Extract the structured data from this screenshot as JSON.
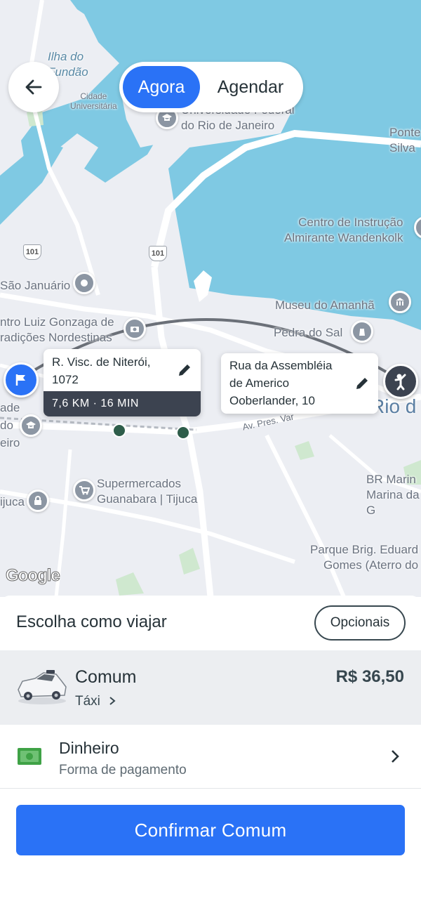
{
  "header": {
    "back_icon": "arrow-left-icon",
    "mode_options": [
      "Agora",
      "Agendar"
    ],
    "selected_mode": "Agora"
  },
  "map": {
    "labels": {
      "ilha": "Ilha do\nFundão",
      "cidade": "Cidade\nUniversitária",
      "ufrj": "Universidade Federal\ndo Rio de Janeiro",
      "ponte": "Ponte\nSilva",
      "centro_instrucao": "Centro de Instrução\nAlmirante Wandenkolk",
      "sao_januario": "São Januário",
      "luiz_gonzaga": "ntro Luiz Gonzaga de\nradições Nordestinas",
      "museu": "Museu do Amanhã",
      "pedra_sal": "Pedra do Sal",
      "rio": "Rio d",
      "supermercados": "Supermercados\nGuanabara | Tijuca",
      "tijuca": "ijuca",
      "ade": "ade\ndo\neiro",
      "br_marina": "BR Marin\nMarina da G",
      "parque": "Parque Brig. Eduard\nGomes (Aterro do",
      "av_pres": "Av. Pres. Var",
      "route_shield": "101"
    },
    "origin": {
      "address": "R. Visc. de Niterói,\n1072",
      "eta": "7,6 KM · 16 MIN"
    },
    "destination": {
      "address": "Rua da Assembléia\nde Americo\nOoberlander, 10"
    },
    "brand": "Google",
    "colors": {
      "water": "#7fc9e3",
      "land": "#eceef3",
      "route": "#6b7078",
      "accent": "#2a72f6"
    }
  },
  "sheet": {
    "title": "Escolha como viajar",
    "options_button": "Opcionais",
    "ride": {
      "name": "Comum",
      "category": "Táxi",
      "price": "R$ 36,50",
      "icon": "taxi-car-icon"
    },
    "payment": {
      "method": "Dinheiro",
      "label": "Forma de pagamento",
      "icon": "cash-icon"
    },
    "confirm_button": "Confirmar Comum"
  }
}
